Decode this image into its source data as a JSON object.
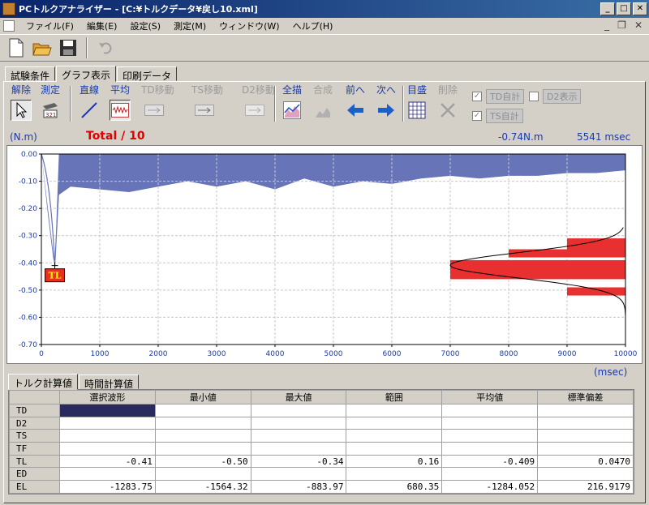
{
  "window": {
    "title": "PCトルクアナライザー - [C:¥トルクデータ¥戻し10.xml]"
  },
  "menu": [
    "ファイル(F)",
    "編集(E)",
    "設定(S)",
    "測定(M)",
    "ウィンドウ(W)",
    "ヘルプ(H)"
  ],
  "tabs_top": [
    "試験条件",
    "グラフ表示",
    "印刷データ"
  ],
  "toolbar2": {
    "buttons": [
      "解除",
      "測定",
      "直線",
      "平均",
      "TD移動",
      "TS移動",
      "D2移動",
      "全描",
      "合成",
      "前へ",
      "次へ",
      "目盛",
      "削除"
    ],
    "checks": [
      {
        "label": "TD自計",
        "checked": true
      },
      {
        "label": "D2表示",
        "checked": false
      },
      {
        "label": "TS自計",
        "checked": true
      }
    ]
  },
  "info": {
    "y_unit": "(N.m)",
    "total_label": "Total / 10",
    "cursor_value": "-0.74N.m",
    "cursor_time": "5541 msec"
  },
  "chart_data": {
    "type": "area",
    "x_label": "(msec)",
    "y_label": "(N.m)",
    "xlim": [
      0,
      10000
    ],
    "ylim": [
      -0.7,
      0.0
    ],
    "x_ticks": [
      "0",
      "1000",
      "2000",
      "3000",
      "4000",
      "5000",
      "6000",
      "7000",
      "8000",
      "9000",
      "10000"
    ],
    "y_ticks": [
      "0.00",
      "-0.10",
      "-0.20",
      "-0.30",
      "-0.40",
      "-0.50",
      "-0.60",
      "-0.70"
    ],
    "peak_marker": {
      "label": "TL",
      "x": 230,
      "y": -0.41
    },
    "series": [
      {
        "x": [
          0,
          100,
          200,
          230,
          300,
          500,
          1000,
          1500,
          2000,
          2500,
          3000,
          3500,
          4000,
          4500,
          5000,
          5500,
          6000,
          6500,
          7000,
          7500,
          8000,
          8500,
          9000,
          9500,
          10000
        ],
        "y": [
          0.0,
          -0.2,
          -0.38,
          -0.41,
          -0.15,
          -0.12,
          -0.13,
          -0.14,
          -0.12,
          -0.1,
          -0.12,
          -0.1,
          -0.13,
          -0.09,
          -0.12,
          -0.1,
          -0.11,
          -0.09,
          -0.08,
          -0.09,
          -0.08,
          -0.08,
          -0.07,
          -0.07,
          -0.06
        ]
      }
    ],
    "histogram": {
      "bins": [
        {
          "y_from": -0.31,
          "y_to": -0.36,
          "x_from": 9000
        },
        {
          "y_from": -0.35,
          "y_to": -0.38,
          "x_from": 8000
        },
        {
          "y_from": -0.39,
          "y_to": -0.46,
          "x_from": 7000
        },
        {
          "y_from": -0.49,
          "y_to": -0.52,
          "x_from": 9000
        }
      ]
    }
  },
  "stats": {
    "tabs": [
      "トルク計算値",
      "時間計算値"
    ],
    "columns": [
      "",
      "選択波形",
      "最小値",
      "最大値",
      "範囲",
      "平均値",
      "標準偏差"
    ],
    "rows": [
      {
        "label": "TD",
        "values": [
          "",
          "",
          "",
          "",
          "",
          ""
        ]
      },
      {
        "label": "D2",
        "values": [
          "",
          "",
          "",
          "",
          "",
          ""
        ]
      },
      {
        "label": "TS",
        "values": [
          "",
          "",
          "",
          "",
          "",
          ""
        ]
      },
      {
        "label": "TF",
        "values": [
          "",
          "",
          "",
          "",
          "",
          ""
        ]
      },
      {
        "label": "TL",
        "values": [
          "-0.41",
          "-0.50",
          "-0.34",
          "0.16",
          "-0.409",
          "0.0470"
        ]
      },
      {
        "label": "ED",
        "values": [
          "",
          "",
          "",
          "",
          "",
          ""
        ]
      },
      {
        "label": "EL",
        "values": [
          "-1283.75",
          "-1564.32",
          "-883.97",
          "680.35",
          "-1284.052",
          "216.9179"
        ]
      }
    ]
  }
}
